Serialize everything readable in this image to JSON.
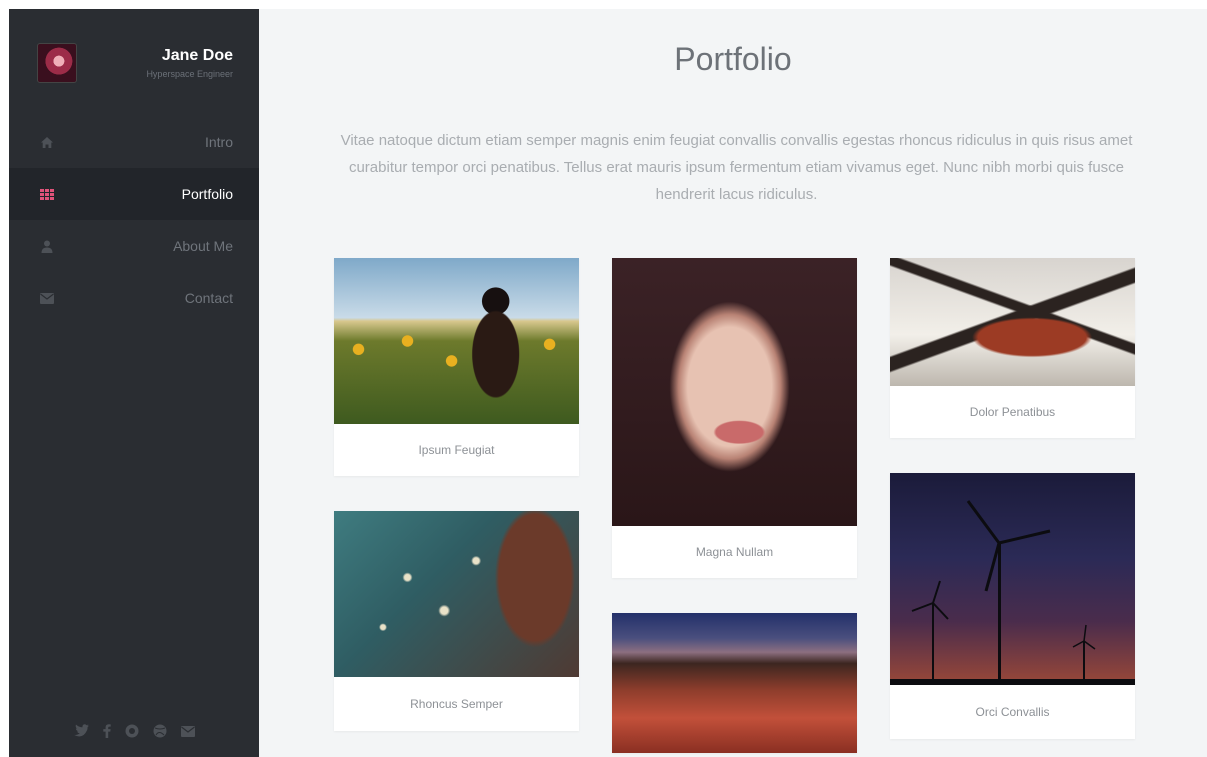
{
  "profile": {
    "name": "Jane Doe",
    "role": "Hyperspace Engineer"
  },
  "nav": [
    {
      "label": "Intro",
      "icon": "home-icon",
      "active": false
    },
    {
      "label": "Portfolio",
      "icon": "grid-icon",
      "active": true
    },
    {
      "label": "About Me",
      "icon": "user-icon",
      "active": false
    },
    {
      "label": "Contact",
      "icon": "envelope-icon",
      "active": false
    }
  ],
  "socials": [
    "twitter-icon",
    "facebook-icon",
    "github-icon",
    "dribbble-icon",
    "email-icon"
  ],
  "main": {
    "title": "Portfolio",
    "intro": "Vitae natoque dictum etiam semper magnis enim feugiat convallis convallis egestas rhoncus ridiculus in quis risus amet curabitur tempor orci penatibus. Tellus erat mauris ipsum fermentum etiam vivamus eget. Nunc nibh morbi quis fusce hendrerit lacus ridiculus."
  },
  "portfolio": [
    {
      "caption": "Ipsum Feugiat"
    },
    {
      "caption": "Magna Nullam"
    },
    {
      "caption": "Dolor Penatibus"
    },
    {
      "caption": "Rhoncus Semper"
    },
    {
      "caption": "Orci Convallis"
    },
    {
      "caption": ""
    }
  ],
  "colors": {
    "sidebar": "#2a2d32",
    "sidebar_active": "#22252a",
    "accent": "#e0537a",
    "main_bg": "#f3f5f6"
  }
}
